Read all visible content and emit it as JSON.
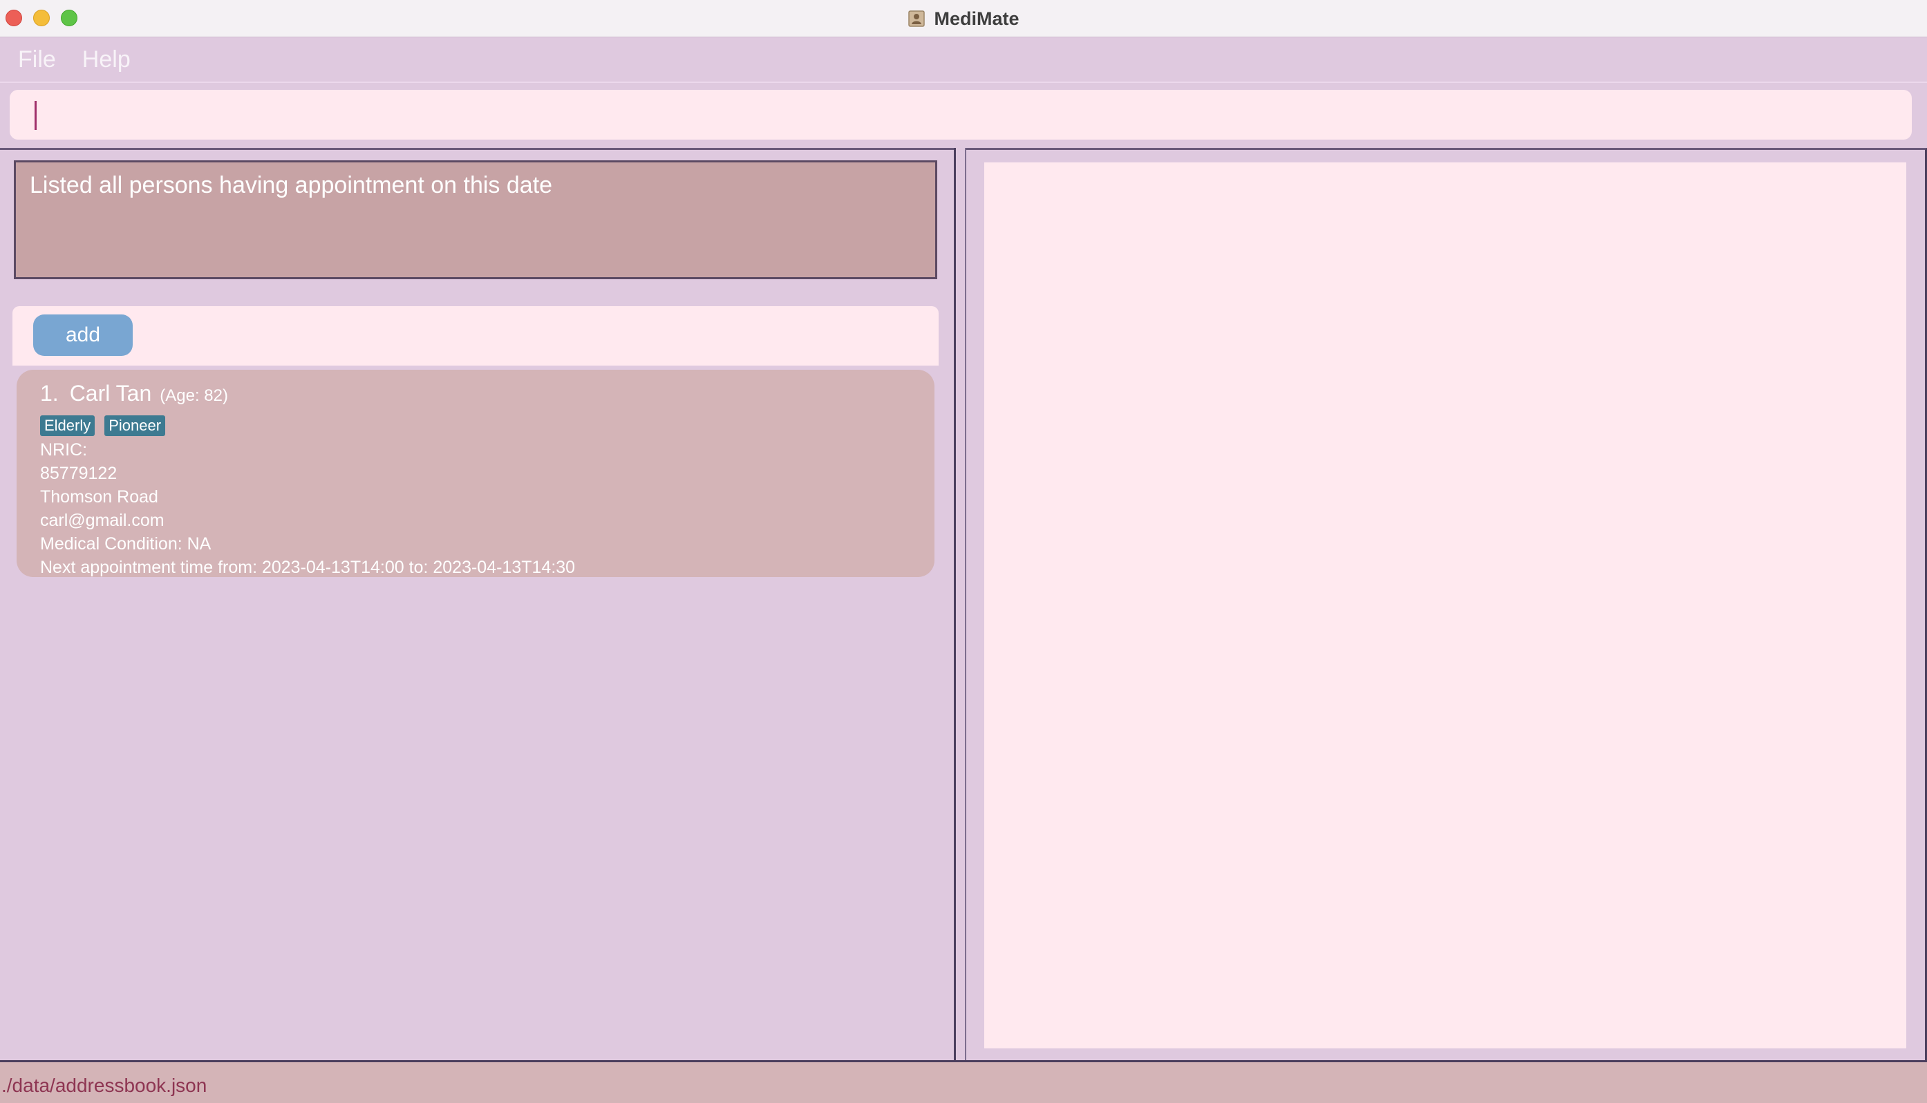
{
  "window": {
    "title": "MediMate",
    "app_icon": "address-book-icon"
  },
  "menu": {
    "items": [
      "File",
      "Help"
    ]
  },
  "command_box": {
    "value": ""
  },
  "result_display": {
    "text": "Listed all persons having appointment on this date"
  },
  "toolbar": {
    "add_label": "add"
  },
  "persons": [
    {
      "index": "1.",
      "name": "Carl Tan",
      "age": "(Age: 82)",
      "tags": [
        "Elderly",
        "Pioneer"
      ],
      "nric": "NRIC:",
      "phone": "85779122",
      "address": "Thomson Road",
      "email": "carl@gmail.com",
      "medical_condition": "Medical Condition: NA",
      "appointment": "Next appointment time from: 2023-04-13T14:00 to: 2023-04-13T14:30"
    }
  ],
  "status_bar": {
    "path": "./data/addressbook.json"
  },
  "colors": {
    "background": "#dfc9df",
    "panel": "#ffe9ef",
    "card": "#d4b4b7",
    "result_box": "#c7a3a5",
    "add_button": "#79a6d2",
    "tag": "#3d7a91",
    "status_text": "#8e3552"
  }
}
